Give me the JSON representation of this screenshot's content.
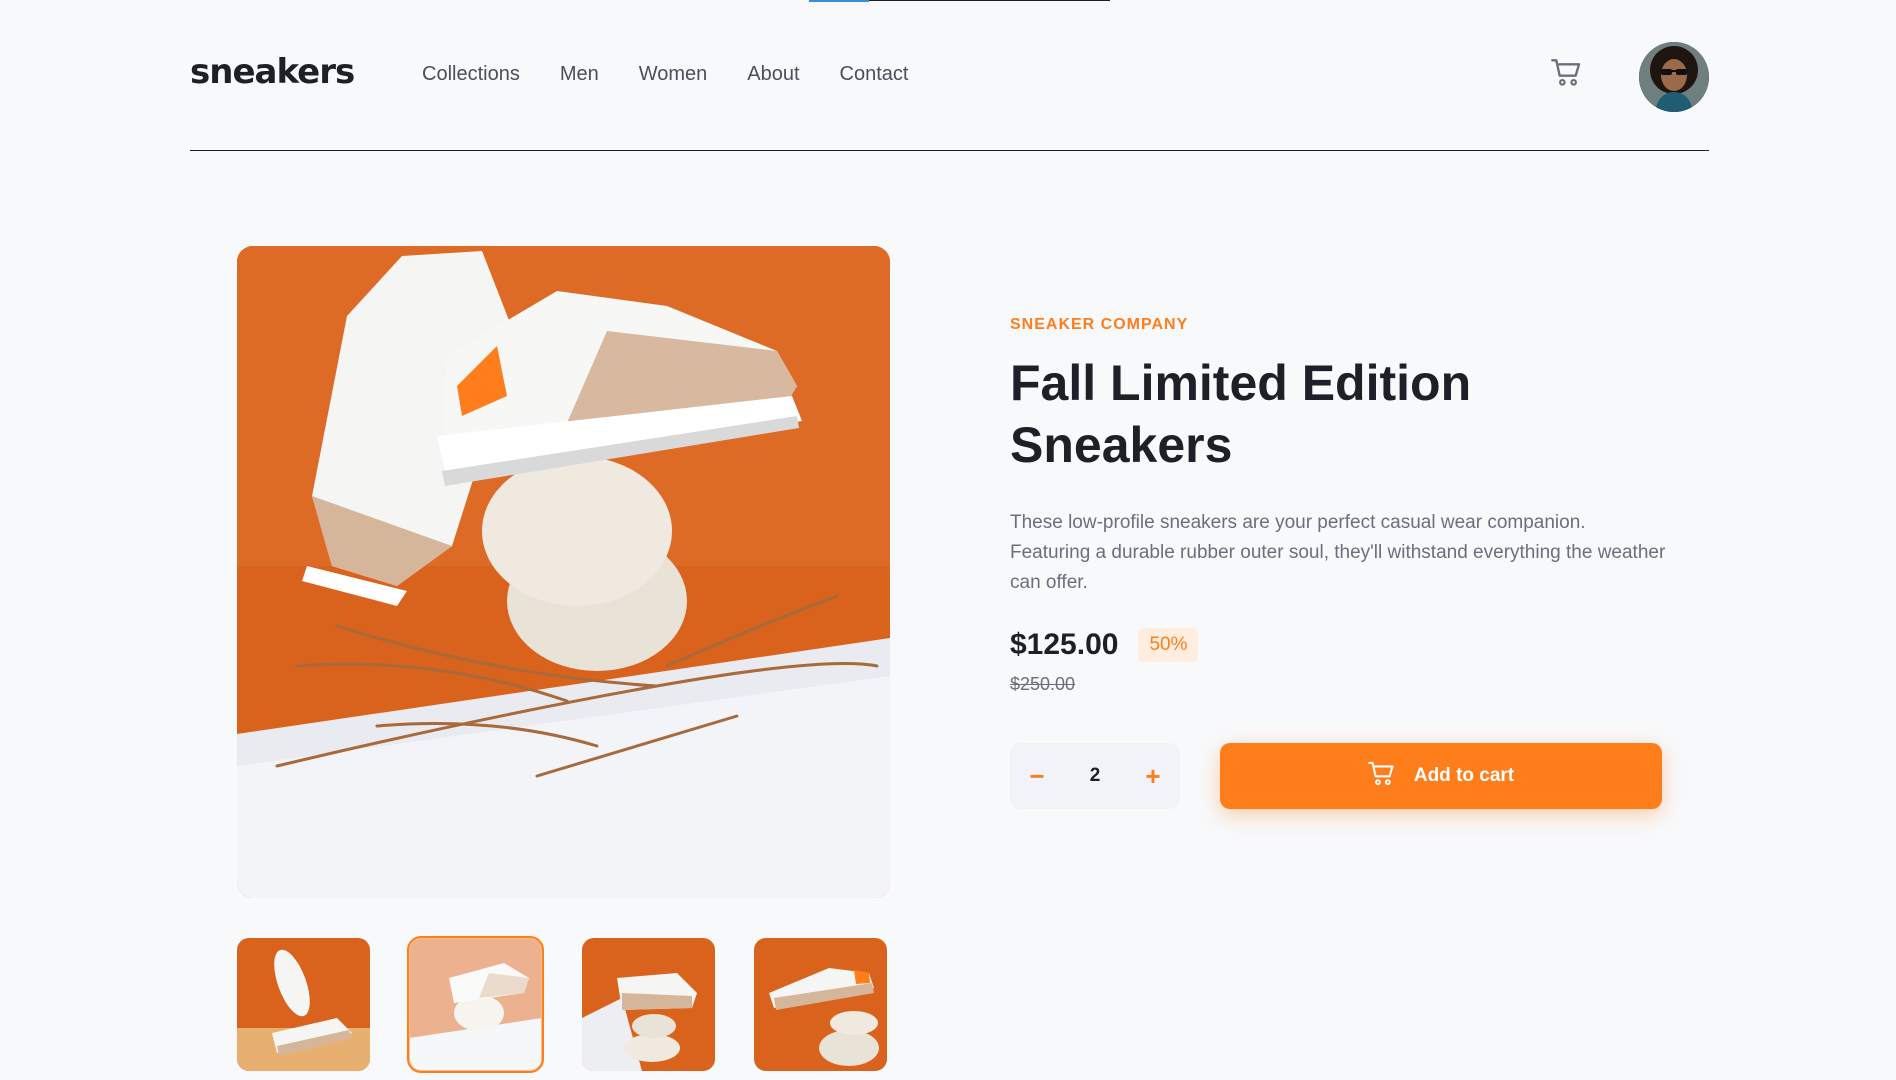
{
  "header": {
    "logo": "sneakers",
    "nav": [
      "Collections",
      "Men",
      "Women",
      "About",
      "Contact"
    ],
    "cart_icon": "cart-icon",
    "avatar_icon": "avatar"
  },
  "product": {
    "company": "SNEAKER COMPANY",
    "title": "Fall Limited Edition Sneakers",
    "description": "These low-profile sneakers are your perfect casual wear companion. Featuring a durable rubber outer soul, they'll withstand everything the weather can offer.",
    "price": "$125.00",
    "discount": "50%",
    "old_price": "$250.00",
    "quantity": "2",
    "quantity_minus": "−",
    "quantity_plus": "+",
    "add_to_cart": "Add to cart"
  },
  "gallery": {
    "active_thumbnail": 2,
    "thumbnail_count": 4
  },
  "colors": {
    "accent": "#ff7e1b",
    "accent_pale": "#ffede0",
    "text_dark": "#1d2026",
    "text_grey": "#68707d"
  }
}
